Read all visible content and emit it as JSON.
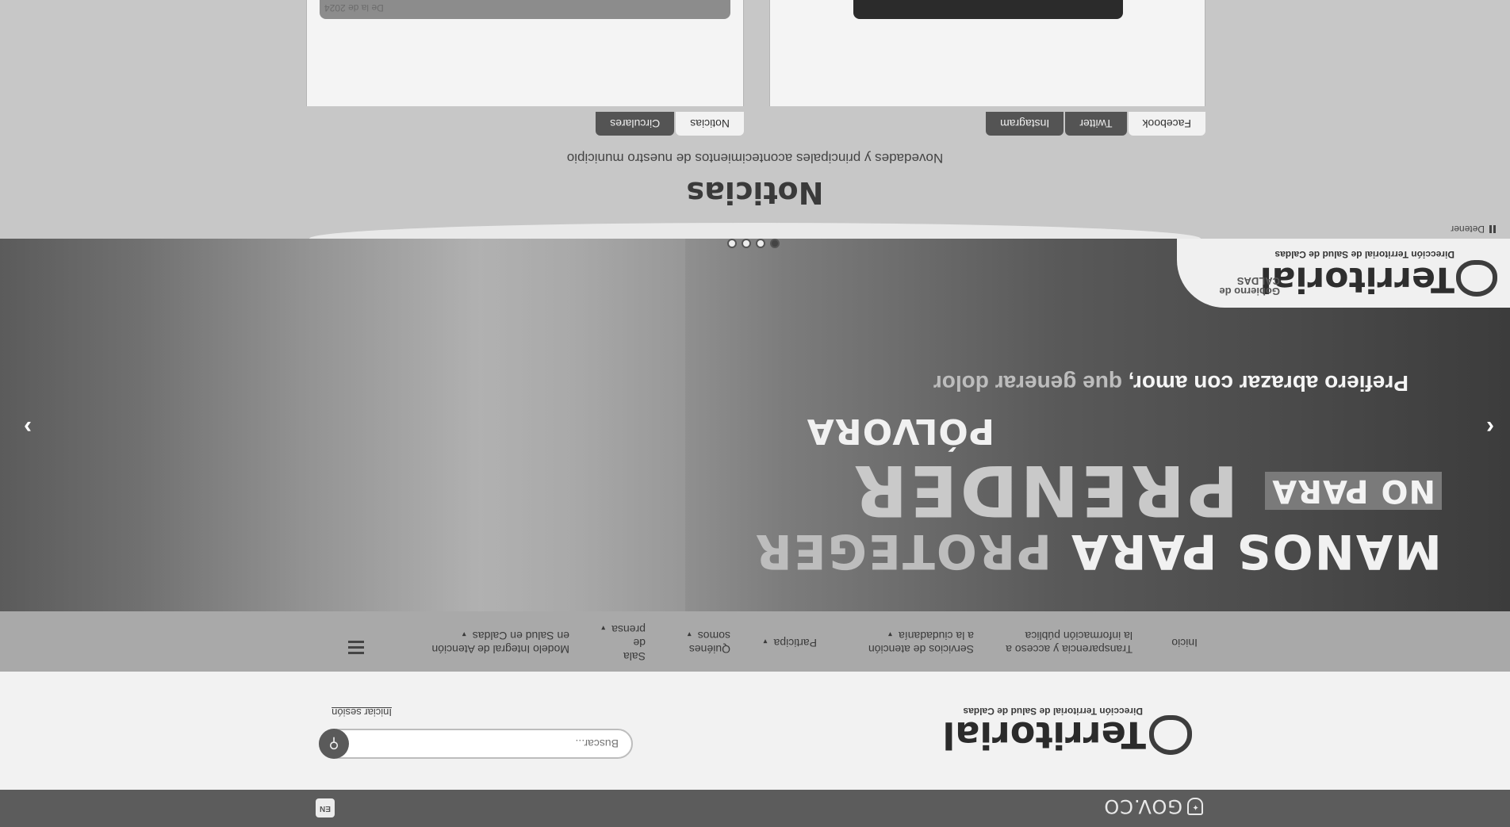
{
  "gov": {
    "logo_text": "GOV.CO",
    "lang_button": "EN"
  },
  "header": {
    "brand_word": "Territorial",
    "brand_sub": "Dirección Territorial de Salud de Caldas",
    "search_placeholder": "Buscar...",
    "login_label": "Iniciar sesión"
  },
  "nav": {
    "items": [
      {
        "label": "Inicio"
      },
      {
        "label": "Transparencia y acceso a\nla información pública"
      },
      {
        "label": "Servicios de atención\na la ciudadanía"
      },
      {
        "label": "Participa"
      },
      {
        "label": "Quiénes\nsomos"
      },
      {
        "label": "Sala\nde\nprensa"
      },
      {
        "label": "Modelo Integral de Atención\nen Salud en Caldas"
      }
    ]
  },
  "hero": {
    "line1_a": "MANOS PARA ",
    "line1_b": "PROTEGER",
    "badge": "NO PARA",
    "line2": "PRENDER",
    "line3": "PÓLVORA",
    "tagline_a": "Prefiero abrazar con amor, ",
    "tagline_b": "que generar dolor",
    "badge_word": "Territorial",
    "badge_sub": "Dirección Territorial de Salud de Caldas",
    "badge_gov_1": "Gobierno de",
    "badge_gov_2": "CALDAS",
    "prev_icon": "‹",
    "next_icon": "›"
  },
  "slider": {
    "pause_label": "Detener"
  },
  "news": {
    "title": "Noticias",
    "subtitle": "Novedades y principales acontecimientos de nuestro municipio",
    "left_tabs": [
      "Facebook",
      "Twitter",
      "Instagram"
    ],
    "right_tabs": [
      "Noticias",
      "Circulares"
    ],
    "date": "De la de 2024"
  }
}
